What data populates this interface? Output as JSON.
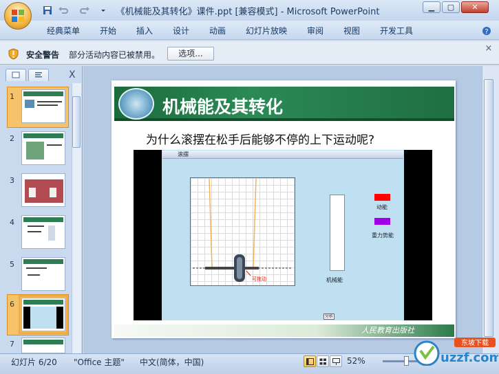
{
  "app": {
    "title": "《机械能及其转化》课件.ppt [兼容模式] - Microsoft PowerPoint",
    "window_controls": {
      "minimize": "▁",
      "maximize": "▢",
      "close": "✕"
    }
  },
  "ribbon": {
    "tabs": [
      "经典菜单",
      "开始",
      "插入",
      "设计",
      "动画",
      "幻灯片放映",
      "审阅",
      "视图",
      "开发工具"
    ]
  },
  "security": {
    "title": "安全警告",
    "message": "部分活动内容已被禁用。",
    "options_label": "选项...",
    "close": "×"
  },
  "thumbnails": {
    "numbers": [
      "1",
      "2",
      "3",
      "4",
      "5",
      "6",
      "7"
    ],
    "selected": 6,
    "close": "X"
  },
  "slide": {
    "title": "机械能及其转化",
    "question": "为什么滚摆在松手后能够不停的上下运动呢?",
    "flash": {
      "window_title": "滚摆",
      "hand_label": "可拖动",
      "mechanical_label": "机械能",
      "kinetic_label": "动能",
      "potential_label": "重力势能",
      "analyze_label": "分析",
      "kinetic_color": "#ff0000",
      "potential_color": "#a000e8"
    },
    "publisher": "人民教育出版社"
  },
  "status": {
    "slide_info": "幻灯片 6/20",
    "theme": "\"Office 主题\"",
    "language": "中文(简体，中国)",
    "zoom": "52%"
  },
  "watermark": {
    "brand": "uzzf.com",
    "tag": "东坡下载"
  },
  "icons": [
    "office-logo-icon",
    "save-icon",
    "undo-icon",
    "redo-icon",
    "shield-icon",
    "slides-tab-icon",
    "outline-tab-icon"
  ]
}
